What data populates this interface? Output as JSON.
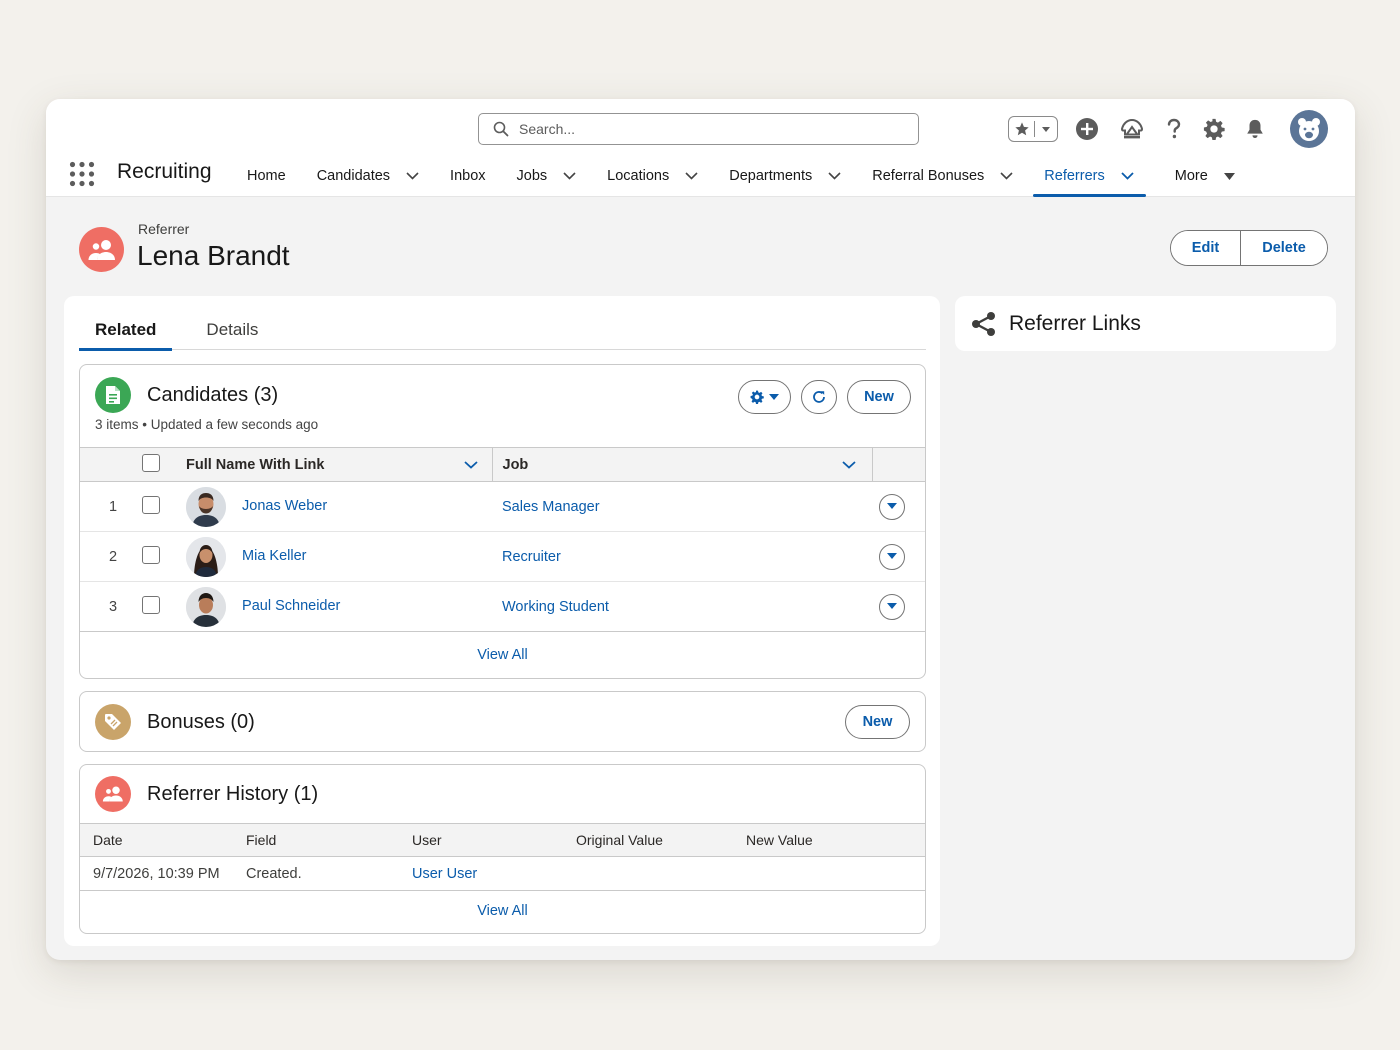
{
  "search": {
    "placeholder": "Search..."
  },
  "app": {
    "name": "Recruiting"
  },
  "nav": {
    "items": [
      {
        "label": "Home",
        "has_menu": false
      },
      {
        "label": "Candidates",
        "has_menu": true
      },
      {
        "label": "Inbox",
        "has_menu": false
      },
      {
        "label": "Jobs",
        "has_menu": true
      },
      {
        "label": "Locations",
        "has_menu": true
      },
      {
        "label": "Departments",
        "has_menu": true
      },
      {
        "label": "Referral Bonuses",
        "has_menu": true
      },
      {
        "label": "Referrers",
        "has_menu": true,
        "active": true
      },
      {
        "label": "More",
        "has_menu": true
      }
    ]
  },
  "record": {
    "type": "Referrer",
    "name": "Lena Brandt"
  },
  "actions": {
    "edit": "Edit",
    "delete": "Delete"
  },
  "tabs": [
    {
      "label": "Related",
      "active": true
    },
    {
      "label": "Details",
      "active": false
    }
  ],
  "candidates": {
    "title": "Candidates (3)",
    "subtitle": "3 items • Updated a few seconds ago",
    "new_label": "New",
    "columns": {
      "name": "Full Name With Link",
      "job": "Job"
    },
    "rows": [
      {
        "num": "1",
        "name": "Jonas Weber",
        "job": "Sales Manager"
      },
      {
        "num": "2",
        "name": "Mia Keller",
        "job": "Recruiter"
      },
      {
        "num": "3",
        "name": "Paul Schneider",
        "job": "Working Student"
      }
    ],
    "view_all": "View All"
  },
  "bonuses": {
    "title": "Bonuses (0)",
    "new_label": "New"
  },
  "history": {
    "title": "Referrer History (1)",
    "columns": {
      "date": "Date",
      "field": "Field",
      "user": "User",
      "original": "Original Value",
      "new": "New Value"
    },
    "rows": [
      {
        "date": "9/7/2026, 10:39 PM",
        "field": "Created.",
        "user": "User User",
        "original": "",
        "new": ""
      }
    ],
    "view_all": "View All"
  },
  "side": {
    "title": "Referrer Links"
  },
  "colors": {
    "brand": "#0b5cab",
    "referrer_icon": "#ef6e64",
    "candidates_icon": "#3ba755",
    "bonus_icon": "#c9a46a"
  }
}
